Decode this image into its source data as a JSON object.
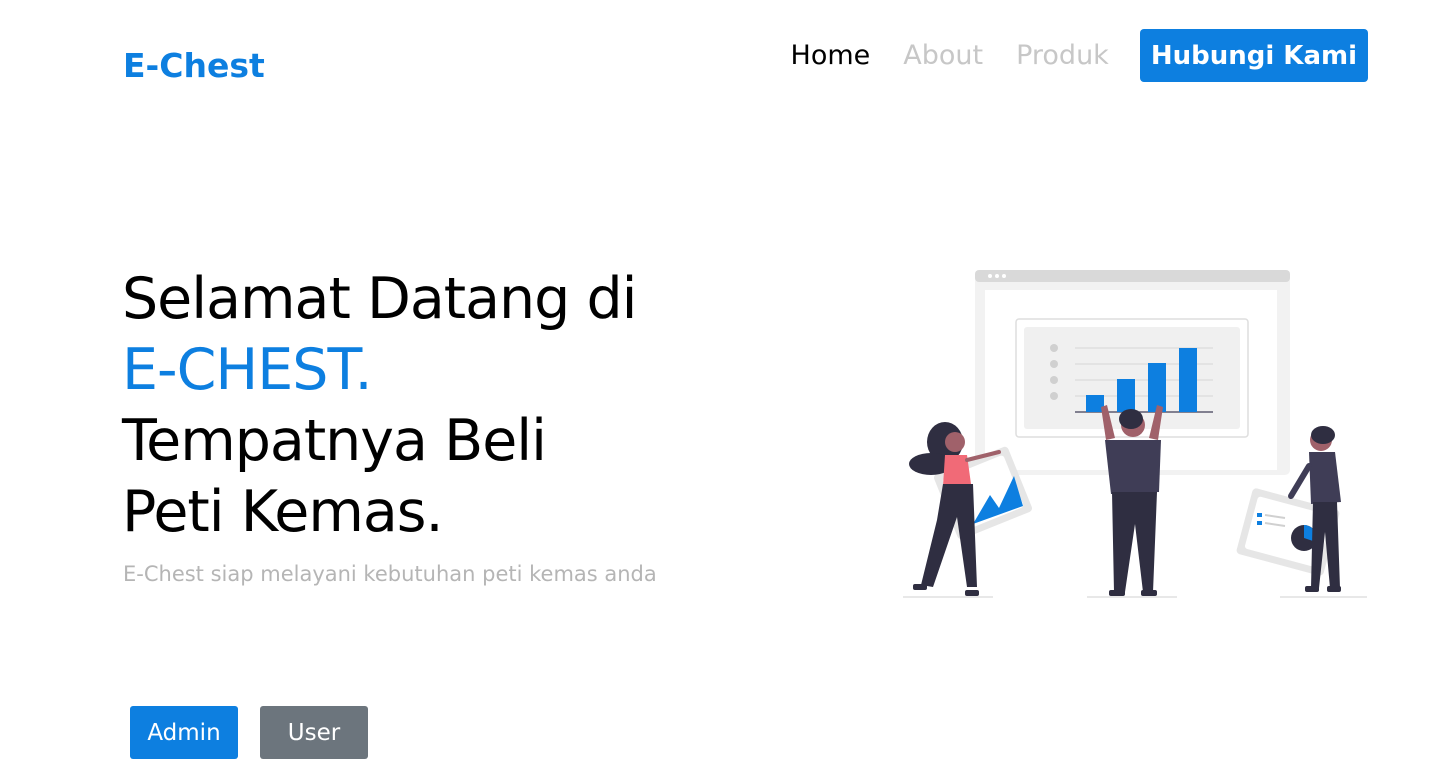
{
  "header": {
    "logo": "E-Chest",
    "nav": [
      {
        "label": "Home",
        "active": true
      },
      {
        "label": "About",
        "active": false
      },
      {
        "label": "Produk",
        "active": false
      }
    ],
    "cta_label": "Hubungi Kami"
  },
  "hero": {
    "line1": "Selamat Datang di",
    "brand": "E-CHEST.",
    "line3": "Tempatnya Beli",
    "line4": "Peti Kemas.",
    "subtitle": "E-Chest siap melayani kebutuhan peti kemas anda"
  },
  "actions": {
    "admin_label": "Admin",
    "user_label": "User"
  },
  "colors": {
    "brand": "#0d7fe0",
    "nav_inactive": "#c7c7c7",
    "secondary_button": "#6c757d",
    "subtitle": "#b5b5b5"
  },
  "illustration": {
    "icon": "people-analytics-illustration"
  }
}
